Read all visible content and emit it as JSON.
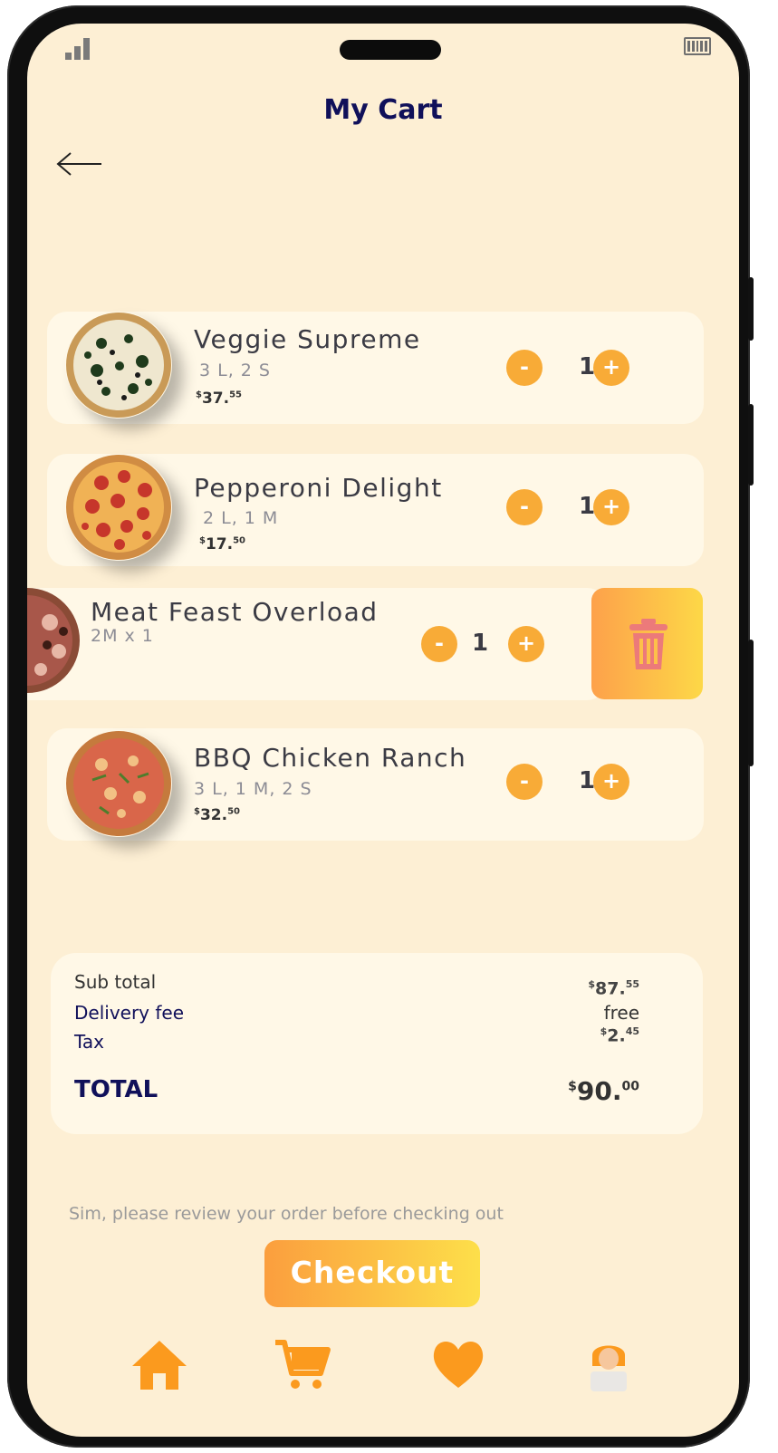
{
  "header": {
    "title": "My Cart"
  },
  "cart": {
    "items": [
      {
        "name": "Veggie Supreme",
        "sizes": "3 L, 2 S",
        "price_currency": "$",
        "price_main": "37.",
        "price_cents": "55",
        "quantity": "1"
      },
      {
        "name": "Pepperoni Delight",
        "sizes": "2 L, 1 M",
        "price_currency": "$",
        "price_main": "17.",
        "price_cents": "50",
        "quantity": "1"
      },
      {
        "name": "Meat Feast Overload",
        "sizes": "2M x 1",
        "quantity": "1"
      },
      {
        "name": "BBQ Chicken Ranch",
        "sizes": "3 L, 1 M, 2 S",
        "price_currency": "$",
        "price_main": "32.",
        "price_cents": "50",
        "quantity": "1"
      }
    ],
    "minus_label": "-",
    "plus_label": "+"
  },
  "summary": {
    "subtotal_label": "Sub total",
    "subtotal_currency": "$",
    "subtotal_main": "87.",
    "subtotal_cents": "55",
    "delivery_label": "Delivery fee",
    "delivery_value": "free",
    "tax_label": "Tax",
    "tax_currency": "$",
    "tax_main": "2.",
    "tax_cents": "45",
    "total_label": "TOTAL",
    "total_currency": "$",
    "total_main": "90.",
    "total_cents": "00"
  },
  "footer": {
    "review_message": "Sim, please review your order before checking out",
    "checkout_label": "Checkout"
  },
  "colors": {
    "accent": "#f8ab37",
    "title": "#10105a",
    "background": "#fdefd4",
    "card": "#fff8e7",
    "delete_icon": "#ec7a7a"
  },
  "icons": [
    "back-arrow-icon",
    "trash-icon",
    "home-icon",
    "cart-icon",
    "heart-icon",
    "profile-icon"
  ]
}
